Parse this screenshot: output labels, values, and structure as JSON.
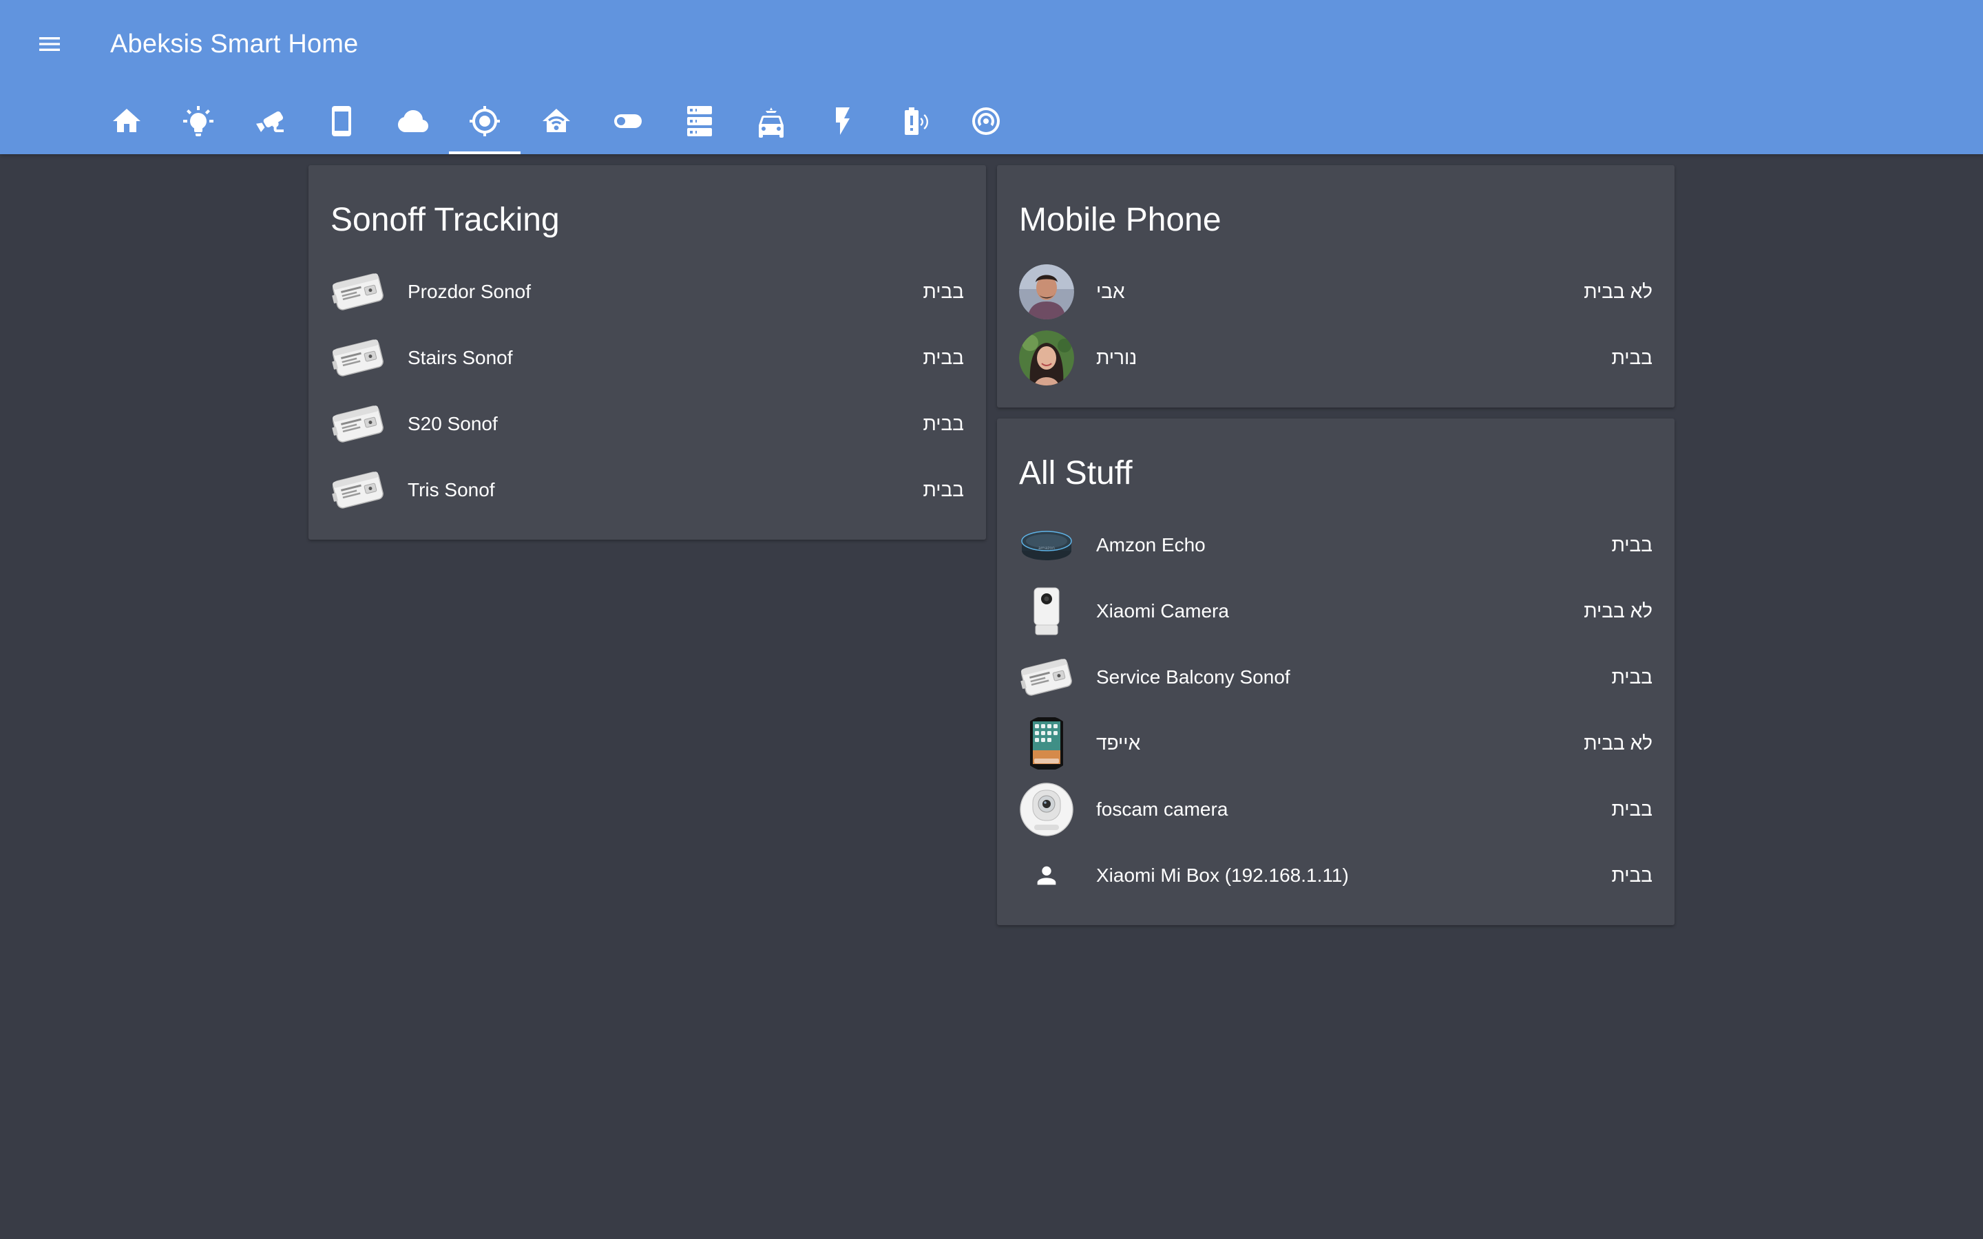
{
  "app": {
    "title": "Abeksis Smart Home"
  },
  "toolbar": {
    "menu_icon": "menu-icon",
    "tabs": [
      {
        "icon": "home-icon"
      },
      {
        "icon": "lightbulb-icon"
      },
      {
        "icon": "cctv-icon"
      },
      {
        "icon": "cellphone-icon"
      },
      {
        "icon": "cloud-icon"
      },
      {
        "icon": "crosshairs-gps-icon",
        "active": true
      },
      {
        "icon": "home-wifi-icon"
      },
      {
        "icon": "toggle-switch-icon"
      },
      {
        "icon": "server-icon"
      },
      {
        "icon": "car-icon"
      },
      {
        "icon": "flash-icon"
      },
      {
        "icon": "battery-alert-icon"
      },
      {
        "icon": "robot-vacuum-icon"
      }
    ]
  },
  "cards": {
    "sonoff": {
      "title": "Sonoff Tracking",
      "items": [
        {
          "name": "Prozdor Sonof",
          "state": "בבית",
          "icon": "sonoff-icon"
        },
        {
          "name": "Stairs Sonof",
          "state": "בבית",
          "icon": "sonoff-icon"
        },
        {
          "name": "S20 Sonof",
          "state": "בבית",
          "icon": "sonoff-icon"
        },
        {
          "name": "Tris Sonof",
          "state": "בבית",
          "icon": "sonoff-icon"
        }
      ]
    },
    "mobile": {
      "title": "Mobile Phone",
      "items": [
        {
          "name": "אבי",
          "state": "לא בבית",
          "icon": "avatar-man"
        },
        {
          "name": "נורית",
          "state": "בבית",
          "icon": "avatar-woman"
        }
      ]
    },
    "all": {
      "title": "All Stuff",
      "items": [
        {
          "name": "Amzon Echo",
          "state": "בבית",
          "icon": "echo-dot-icon"
        },
        {
          "name": "Xiaomi Camera",
          "state": "לא בבית",
          "icon": "xiaomi-camera-icon"
        },
        {
          "name": "Service Balcony Sonof",
          "state": "בבית",
          "icon": "sonoff-icon"
        },
        {
          "name": "אייפד",
          "state": "לא בבית",
          "icon": "ipad-icon"
        },
        {
          "name": "foscam camera",
          "state": "בבית",
          "icon": "foscam-camera-icon"
        },
        {
          "name": "Xiaomi Mi Box (192.168.1.11)",
          "state": "בבית",
          "icon": "account-icon"
        }
      ]
    }
  },
  "colors": {
    "header": "#6194de",
    "background": "#393c46",
    "card": "#464952",
    "text": "#ffffff"
  }
}
